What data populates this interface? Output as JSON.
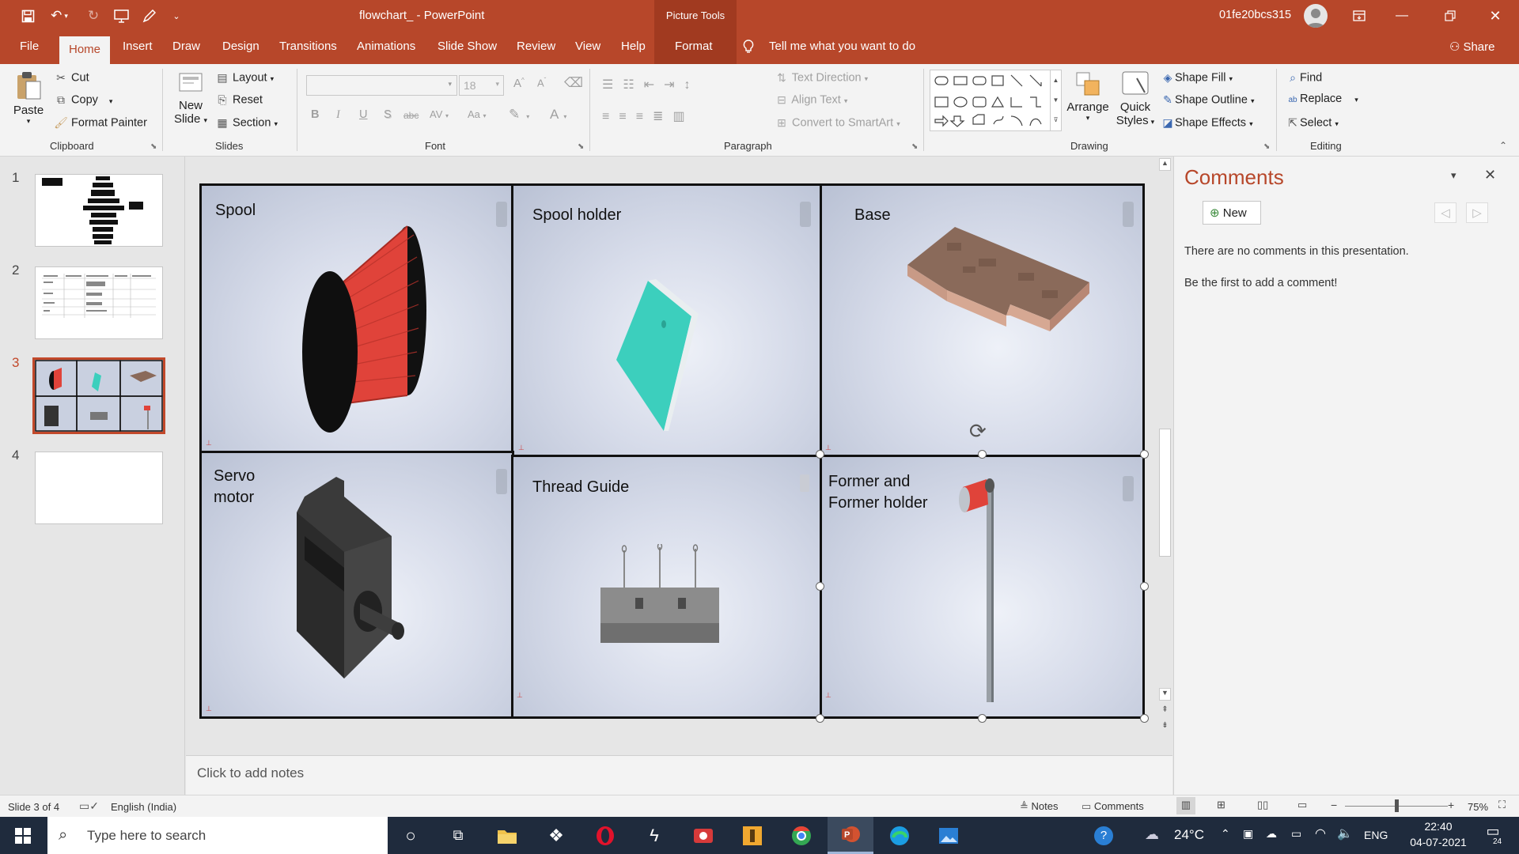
{
  "titlebar": {
    "doc_title": "flowchart_  -  PowerPoint",
    "context_label": "Picture Tools",
    "user_name": "01fe20bcs315",
    "quick_access": [
      "save-icon",
      "undo-icon",
      "redo-icon",
      "present-icon",
      "draw-icon",
      "customize-icon"
    ]
  },
  "menu": {
    "tabs": [
      "File",
      "Home",
      "Insert",
      "Draw",
      "Design",
      "Transitions",
      "Animations",
      "Slide Show",
      "Review",
      "View",
      "Help",
      "Format"
    ],
    "active_tab": "Home",
    "tell_me": "Tell me what you want to do",
    "share": "Share"
  },
  "ribbon": {
    "clipboard": {
      "paste": "Paste",
      "cut": "Cut",
      "copy": "Copy",
      "format_painter": "Format Painter",
      "group": "Clipboard"
    },
    "slides": {
      "new_slide_1": "New",
      "new_slide_2": "Slide",
      "layout": "Layout",
      "reset": "Reset",
      "section": "Section",
      "group": "Slides"
    },
    "font": {
      "font_name": "",
      "font_size": "18",
      "group": "Font",
      "bold": "B",
      "italic": "I",
      "underline": "U",
      "shadow": "S",
      "strike": "abc",
      "spacing": "AV",
      "case": "Aa",
      "color": "A"
    },
    "paragraph": {
      "text_direction": "Text Direction",
      "align_text": "Align Text",
      "convert_smartart": "Convert to SmartArt",
      "group": "Paragraph"
    },
    "drawing": {
      "arrange": "Arrange",
      "quick_1": "Quick",
      "quick_2": "Styles",
      "shape_fill": "Shape Fill",
      "shape_outline": "Shape Outline",
      "shape_effects": "Shape Effects",
      "group": "Drawing"
    },
    "editing": {
      "find": "Find",
      "replace": "Replace",
      "select": "Select",
      "group": "Editing"
    }
  },
  "thumbnails": [
    {
      "num": "1",
      "selected": false
    },
    {
      "num": "2",
      "selected": false
    },
    {
      "num": "3",
      "selected": true
    },
    {
      "num": "4",
      "selected": false
    }
  ],
  "slide": {
    "cells": [
      {
        "label": "Spool"
      },
      {
        "label": "Spool holder"
      },
      {
        "label": "Base"
      },
      {
        "label": "Servo\nmotor"
      },
      {
        "label": "Thread Guide"
      },
      {
        "label": "Former and\nFormer holder"
      }
    ]
  },
  "notes": {
    "placeholder": "Click to add notes"
  },
  "comments": {
    "title": "Comments",
    "new_button": "New",
    "empty_1": "There are no comments in this presentation.",
    "empty_2": "Be the first to add a comment!"
  },
  "status": {
    "slide_info": "Slide 3 of 4",
    "language": "English (India)",
    "notes": "Notes",
    "comments": "Comments",
    "zoom": "75%",
    "zoom_level": 0.5
  },
  "taskbar": {
    "search_placeholder": "Type here to search",
    "temperature": "24°C",
    "input_lang": "ENG",
    "time": "22:40",
    "date": "04-07-2021",
    "notification_count": "24"
  },
  "colors": {
    "accent": "#b7472a",
    "taskbar": "#1f2b3d",
    "spool_red": "#e0433a",
    "holder_teal": "#3ccfbd",
    "wood": "#8a6a5a"
  }
}
